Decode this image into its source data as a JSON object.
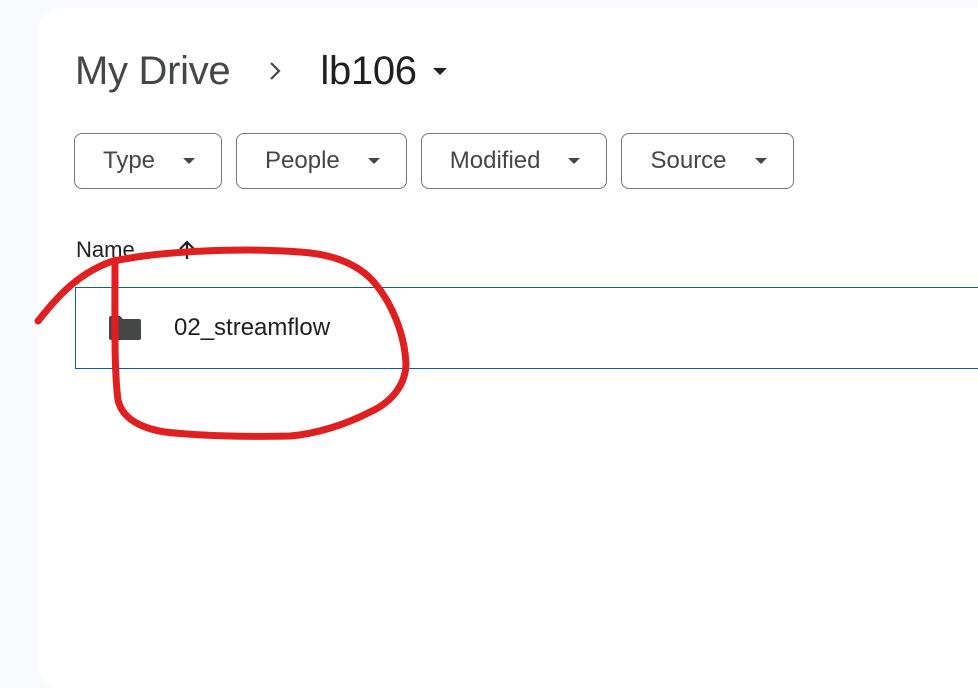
{
  "breadcrumb": {
    "root_label": "My Drive",
    "separator_icon": "chevron-right-icon",
    "current_label": "lb106",
    "current_dropdown_icon": "caret-down-icon"
  },
  "filters": [
    {
      "label": "Type",
      "icon": "caret-down-icon"
    },
    {
      "label": "People",
      "icon": "caret-down-icon"
    },
    {
      "label": "Modified",
      "icon": "caret-down-icon"
    },
    {
      "label": "Source",
      "icon": "caret-down-icon"
    }
  ],
  "list": {
    "column_name_label": "Name",
    "sort_icon": "arrow-up-icon",
    "rows": [
      {
        "name": "02_streamflow",
        "icon": "folder-icon",
        "selected": true
      }
    ]
  },
  "annotation": {
    "type": "hand-drawn-circle",
    "color": "#e02020"
  },
  "colors": {
    "background": "#f8fafd",
    "panel": "#ffffff",
    "selection_border": "#0b57d0",
    "chip_border": "#747775",
    "text_primary": "#1f1f1f",
    "text_secondary": "#444746"
  }
}
